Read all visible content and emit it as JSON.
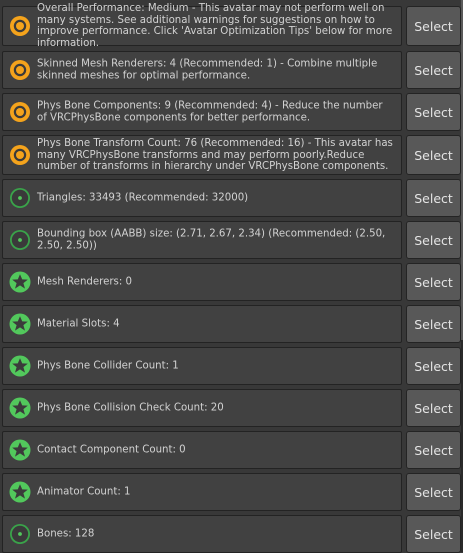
{
  "colors": {
    "warning": "#f4a31c",
    "good": "#52c85c",
    "neutral": "#3aa34a"
  },
  "select_label": "Select",
  "items": [
    {
      "icon": "warning-icon",
      "text": "Overall Performance: Medium - This avatar may not perform well on many systems. See additional warnings for suggestions on how to improve performance. Click 'Avatar Optimization Tips' below for more information."
    },
    {
      "icon": "warning-icon",
      "text": "Skinned Mesh Renderers: 4 (Recommended: 1) - Combine multiple skinned meshes for optimal performance."
    },
    {
      "icon": "warning-icon",
      "text": "Phys Bone Components: 9 (Recommended: 4) - Reduce the number of VRCPhysBone components for better performance."
    },
    {
      "icon": "warning-icon",
      "text": "Phys Bone Transform Count: 76 (Recommended: 16) - This avatar has many VRCPhysBone transforms and may perform poorly.Reduce number of transforms in hierarchy under VRCPhysBone components."
    },
    {
      "icon": "good-circle-icon",
      "text": "Triangles: 33493 (Recommended: 32000)"
    },
    {
      "icon": "good-circle-icon",
      "text": "Bounding box (AABB) size: (2.71, 2.67, 2.34) (Recommended: (2.50, 2.50, 2.50))"
    },
    {
      "icon": "excellent-star-icon",
      "text": "Mesh Renderers: 0"
    },
    {
      "icon": "excellent-star-icon",
      "text": "Material Slots: 4"
    },
    {
      "icon": "excellent-star-icon",
      "text": "Phys Bone Collider Count: 1"
    },
    {
      "icon": "excellent-star-icon",
      "text": "Phys Bone Collision Check Count: 20"
    },
    {
      "icon": "excellent-star-icon",
      "text": "Contact Component Count: 0"
    },
    {
      "icon": "excellent-star-icon",
      "text": "Animator Count: 1"
    },
    {
      "icon": "good-circle-icon",
      "text": "Bones: 128"
    }
  ]
}
